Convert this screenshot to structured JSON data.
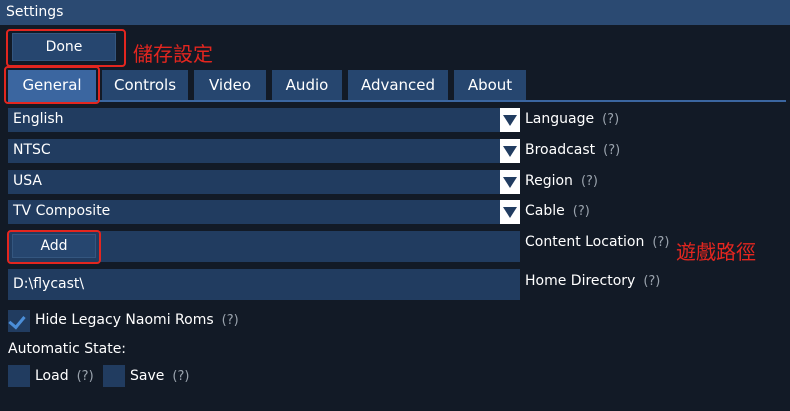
{
  "window": {
    "title": "Settings"
  },
  "done_button": {
    "label": "Done"
  },
  "annotations": {
    "save_settings": "儲存設定",
    "game_path": "遊戲路徑"
  },
  "tabs": [
    {
      "label": "General",
      "active": true
    },
    {
      "label": "Controls"
    },
    {
      "label": "Video"
    },
    {
      "label": "Audio"
    },
    {
      "label": "Advanced"
    },
    {
      "label": "About"
    }
  ],
  "help_glyph": "(?)",
  "settings": {
    "language": {
      "label": "Language",
      "value": "English"
    },
    "broadcast": {
      "label": "Broadcast",
      "value": "NTSC"
    },
    "region": {
      "label": "Region",
      "value": "USA"
    },
    "cable": {
      "label": "Cable",
      "value": "TV Composite"
    },
    "content_location": {
      "label": "Content Location",
      "add_label": "Add"
    },
    "home_directory": {
      "label": "Home Directory",
      "value": "D:\\flycast\\"
    },
    "hide_legacy_naomi": {
      "label": "Hide Legacy Naomi Roms",
      "checked": true
    },
    "automatic_state": {
      "label": "Automatic State:",
      "load": {
        "label": "Load",
        "checked": false
      },
      "save": {
        "label": "Save",
        "checked": false
      }
    }
  },
  "colors": {
    "background": "#121a26",
    "accent": "#3b66a0",
    "control": "#213c60",
    "annotation": "#e3261f"
  }
}
